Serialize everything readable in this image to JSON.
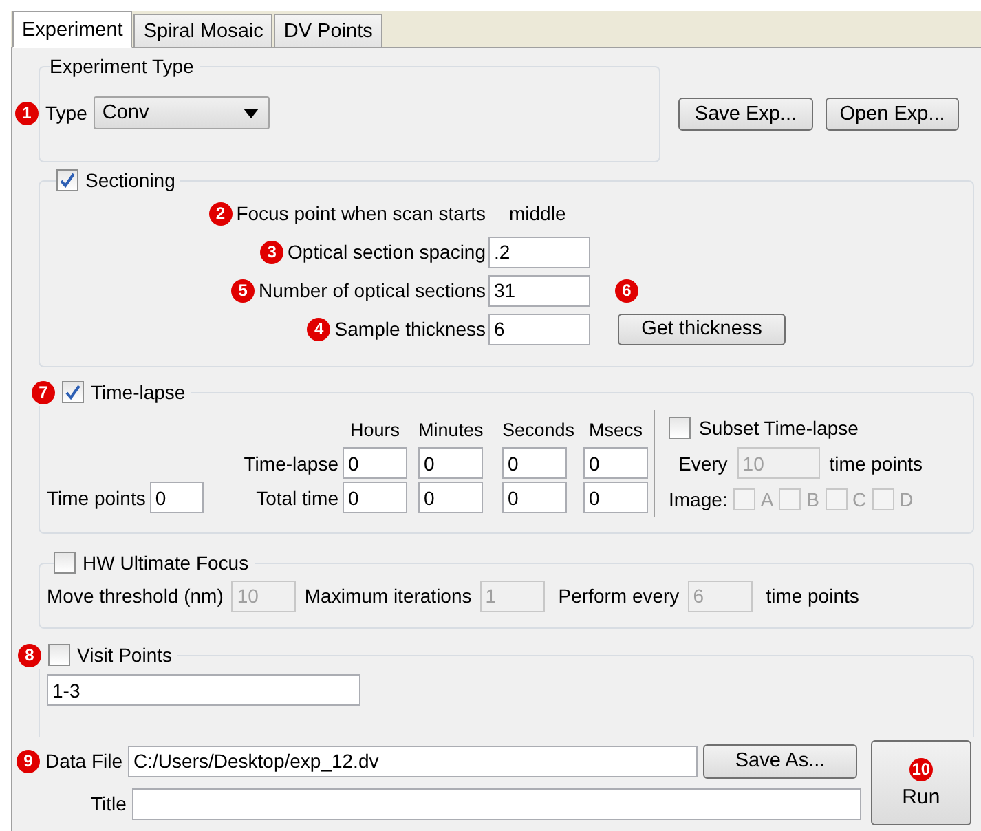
{
  "tabs": [
    {
      "label": "Experiment",
      "selected": true
    },
    {
      "label": "Spiral Mosaic",
      "selected": false
    },
    {
      "label": "DV Points",
      "selected": false
    }
  ],
  "experiment_type": {
    "title": "Experiment Type",
    "marker": "1",
    "label": "Type",
    "value": "Conv"
  },
  "buttons": [
    "Save Exp...",
    "Open Exp..."
  ],
  "sectioning": {
    "label": "Sectioning",
    "checked": true,
    "focus": {
      "marker": "2",
      "label": "Focus point when scan starts",
      "value": "middle"
    },
    "fields": [
      {
        "marker": "3",
        "label": "Optical section spacing",
        "value": ".2"
      },
      {
        "marker": "5",
        "label": "Number of optical sections",
        "value": "31",
        "after_marker": "6"
      },
      {
        "marker": "4",
        "label": "Sample thickness",
        "value": "6",
        "button": "Get thickness"
      }
    ]
  },
  "time_lapse": {
    "marker": "7",
    "label": "Time-lapse",
    "checked": true,
    "columns": [
      "Hours",
      "Minutes",
      "Seconds",
      "Msecs"
    ],
    "rows": [
      {
        "label": "Time-lapse",
        "values": [
          "0",
          "0",
          "0",
          "0"
        ]
      },
      {
        "label": "Total time",
        "values": [
          "0",
          "0",
          "0",
          "0"
        ]
      }
    ],
    "time_points": {
      "label": "Time points",
      "value": "0"
    },
    "subset": {
      "label": "Subset Time-lapse",
      "checked": false,
      "every_label": "Every",
      "every_value": "10",
      "every_suffix": "time points",
      "image_label": "Image:",
      "images": [
        {
          "label": "A",
          "checked": false
        },
        {
          "label": "B",
          "checked": false
        },
        {
          "label": "C",
          "checked": false
        },
        {
          "label": "D",
          "checked": false
        }
      ]
    }
  },
  "hw_focus": {
    "label": "HW Ultimate Focus",
    "checked": false,
    "fields": [
      {
        "label": "Move threshold (nm)",
        "value": "10"
      },
      {
        "label": "Maximum iterations",
        "value": "1"
      },
      {
        "label": "Perform every",
        "value": "6"
      }
    ],
    "suffix": "time points"
  },
  "visit_points": {
    "marker": "8",
    "label": "Visit Points",
    "checked": false,
    "value": "1-3"
  },
  "data_file": {
    "marker": "9",
    "label": "Data File",
    "value": "C:/Users/Desktop/exp_12.dv",
    "button": "Save As..."
  },
  "title_field": {
    "label": "Title"
  },
  "run": {
    "marker": "10",
    "label": "Run"
  }
}
